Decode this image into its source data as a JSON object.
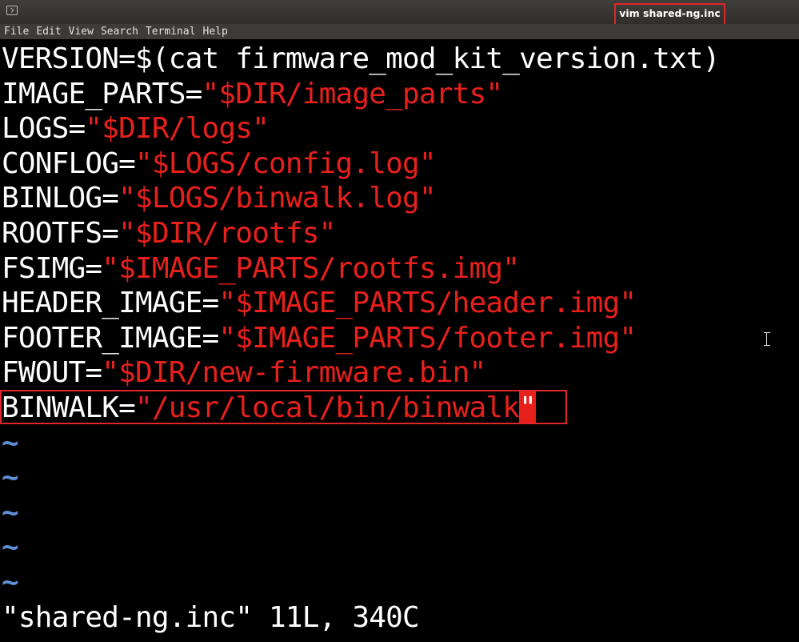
{
  "window": {
    "title": "vim shared-ng.inc"
  },
  "menu": [
    "File",
    "Edit",
    "View",
    "Search",
    "Terminal",
    "Help"
  ],
  "lines": [
    {
      "key": "VERSION=",
      "value": "$(cat firmware_mod_kit_version.txt)",
      "value_type": "plain"
    },
    {
      "key": "IMAGE_PARTS=",
      "value": "\"$DIR/image_parts\"",
      "value_type": "string"
    },
    {
      "key": "LOGS=",
      "value": "\"$DIR/logs\"",
      "value_type": "string"
    },
    {
      "key": "CONFLOG=",
      "value": "\"$LOGS/config.log\"",
      "value_type": "string"
    },
    {
      "key": "BINLOG=",
      "value": "\"$LOGS/binwalk.log\"",
      "value_type": "string"
    },
    {
      "key": "ROOTFS=",
      "value": "\"$DIR/rootfs\"",
      "value_type": "string"
    },
    {
      "key": "FSIMG=",
      "value": "\"$IMAGE_PARTS/rootfs.img\"",
      "value_type": "string"
    },
    {
      "key": "HEADER_IMAGE=",
      "value": "\"$IMAGE_PARTS/header.img\"",
      "value_type": "string"
    },
    {
      "key": "FOOTER_IMAGE=",
      "value": "\"$IMAGE_PARTS/footer.img\"",
      "value_type": "string"
    },
    {
      "key": "FWOUT=",
      "value": "\"$DIR/new-firmware.bin\"",
      "value_type": "string"
    },
    {
      "key": "BINWALK=",
      "value": "\"/usr/local/bin/binwalk",
      "cursor_char": "\"",
      "value_type": "string"
    }
  ],
  "empty_line_marker": "~",
  "empty_line_count": 5,
  "status_line": "\"shared-ng.inc\" 11L, 340C",
  "colors": {
    "background": "#000000",
    "text": "#ffffff",
    "string": "#e8201c",
    "tilde": "#5e8fd6",
    "highlight_box": "#e0262a"
  }
}
